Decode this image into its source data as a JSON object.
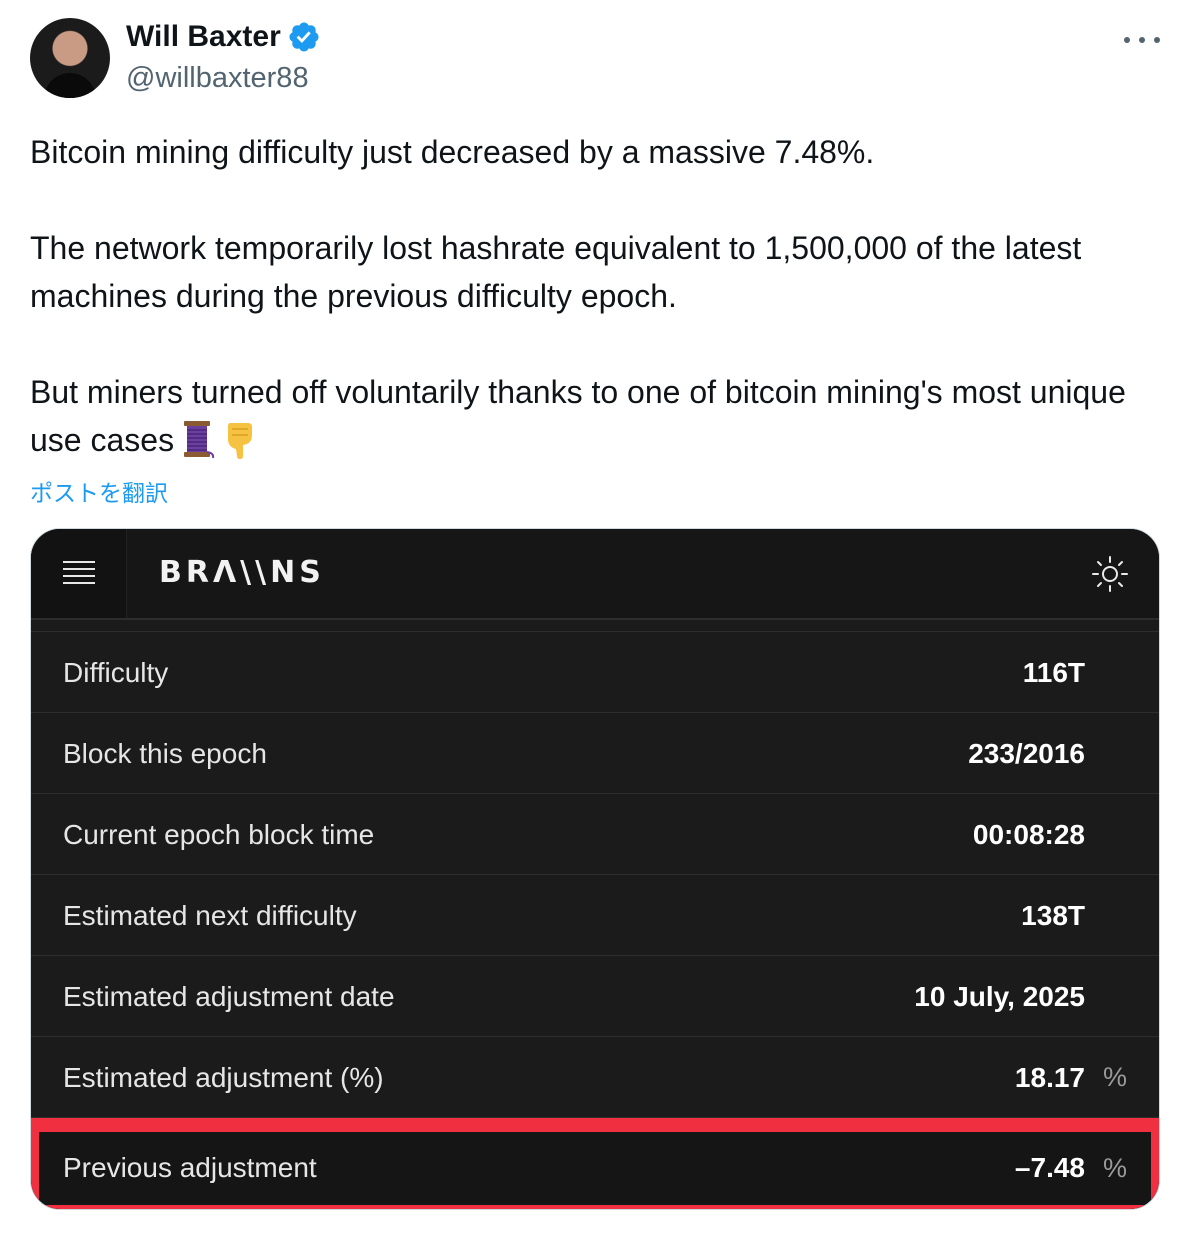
{
  "author": {
    "display_name": "Will Baxter",
    "handle": "@willbaxter88"
  },
  "tweet": {
    "paragraphs": [
      "Bitcoin mining difficulty just decreased by a massive 7.48%.",
      "The network temporarily lost hashrate equivalent to 1,500,000 of the latest machines during the previous difficulty epoch.",
      "But miners turned off voluntarily thanks to one of bitcoin mining's most unique use cases"
    ],
    "emojis": [
      "thread-spool-icon",
      "pointing-down-icon"
    ],
    "translate_label": "ポストを翻訳"
  },
  "card": {
    "brand": "BRΛ\\\\NS",
    "rows": [
      {
        "label": "Difficulty",
        "value": "116T",
        "unit": ""
      },
      {
        "label": "Block this epoch",
        "value": "233/2016",
        "unit": ""
      },
      {
        "label": "Current epoch block time",
        "value": "00:08:28",
        "unit": ""
      },
      {
        "label": "Estimated next difficulty",
        "value": "138T",
        "unit": ""
      },
      {
        "label": "Estimated adjustment date",
        "value": "10 July, 2025",
        "unit": ""
      },
      {
        "label": "Estimated adjustment (%)",
        "value": "18.17",
        "unit": "%"
      },
      {
        "label": "Previous adjustment",
        "value": "–7.48",
        "unit": "%",
        "highlighted": true
      }
    ]
  },
  "colors": {
    "verified": "#1d9bf0",
    "link": "#1d9bf0",
    "card_bg": "#1b1b1b",
    "highlight_border": "#f03040"
  }
}
